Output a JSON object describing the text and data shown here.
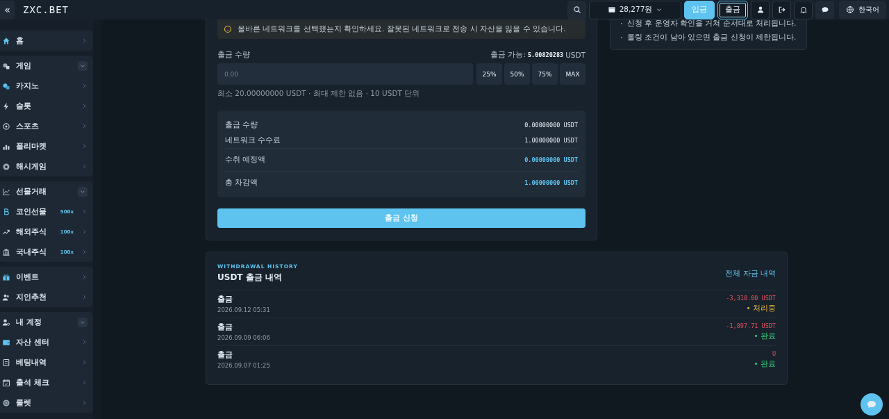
{
  "header": {
    "collapse": "«",
    "logo": "ZXC.BET",
    "balance": "28,277원",
    "actions": [
      {
        "label": "입금",
        "kind": "primary",
        "selected": false
      },
      {
        "label": "출금",
        "kind": "outline",
        "selected": true
      }
    ],
    "language": "한국어"
  },
  "sidebar": {
    "groups": [
      {
        "items": [
          {
            "label": "홈",
            "kind": "link"
          }
        ]
      },
      {
        "items": [
          {
            "label": "게임",
            "kind": "section",
            "expanded": true
          },
          {
            "label": "카지노",
            "kind": "link"
          },
          {
            "label": "슬롯",
            "kind": "link"
          },
          {
            "label": "스포츠",
            "kind": "link"
          },
          {
            "label": "폴리마켓",
            "kind": "link"
          },
          {
            "label": "해시게임",
            "kind": "link"
          }
        ]
      },
      {
        "items": [
          {
            "label": "선물거래",
            "kind": "section",
            "expanded": true
          },
          {
            "label": "코인선물",
            "kind": "link",
            "badge": "500x"
          },
          {
            "label": "해외주식",
            "kind": "link",
            "badge": "100x"
          },
          {
            "label": "국내주식",
            "kind": "link",
            "badge": "100x"
          }
        ]
      },
      {
        "items": [
          {
            "label": "이벤트",
            "kind": "link"
          },
          {
            "label": "지인추천",
            "kind": "link"
          }
        ]
      },
      {
        "items": [
          {
            "label": "내 계정",
            "kind": "section",
            "expanded": true
          },
          {
            "label": "자산 센터",
            "kind": "link"
          },
          {
            "label": "베팅내역",
            "kind": "link"
          },
          {
            "label": "출석 체크",
            "kind": "link"
          },
          {
            "label": "룰렛",
            "kind": "link"
          }
        ]
      }
    ]
  },
  "withdraw": {
    "warning": "올바른 네트워크를 선택했는지 확인하세요. 잘못된 네트워크로 전송 시 자산을 잃을 수 있습니다.",
    "amount_label": "출금 수량",
    "available_label": "출금 가능:",
    "available_value": "5.00820283",
    "available_unit": "USDT",
    "amount_placeholder": "0.00",
    "quick": [
      "25%",
      "50%",
      "75%",
      "MAX"
    ],
    "hint": "최소 20.00000000 USDT · 최대 제한 없음 · 10 USDT 단위",
    "summary": [
      {
        "label": "출금 수량",
        "value": "0.00000000 USDT",
        "kind": "plain"
      },
      {
        "label": "네트워크 수수료",
        "value": "1.00000000 USDT",
        "kind": "plain"
      },
      {
        "label": "수취 예정액",
        "value": "0.00000000 USDT",
        "kind": "accent"
      },
      {
        "label": "총 차감액",
        "value": "1.00000000 USDT",
        "kind": "accent"
      }
    ],
    "submit": "출금 신청"
  },
  "notes": [
    "신청 후 운영자 확인을 거쳐 순서대로 처리됩니다.",
    "롤링 조건이 남아 있으면 출금 신청이 제한됩니다."
  ],
  "history": {
    "eyebrow": "WITHDRAWAL HISTORY",
    "title": "USDT 출금 내역",
    "link": "전체 자금 내역",
    "rows": [
      {
        "type": "출금",
        "date": "2026.09.12 05:31",
        "amount": "-3,310.00 USDT",
        "status": "• 처리중",
        "kind": "pending"
      },
      {
        "type": "출금",
        "date": "2026.09.09 06:06",
        "amount": "-1,897.71 USDT",
        "status": "• 완료",
        "kind": "done"
      },
      {
        "type": "출금",
        "date": "2026.09.07 01:25",
        "amount": "U",
        "status": "• 완료",
        "kind": "done"
      }
    ]
  }
}
